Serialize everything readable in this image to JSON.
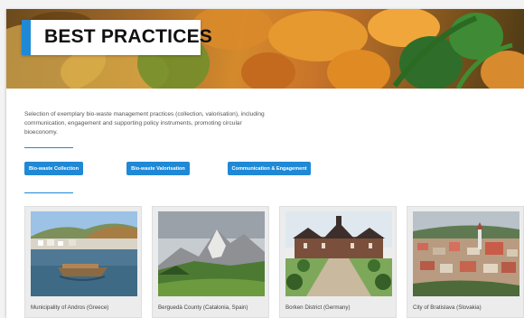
{
  "hero": {
    "title": "BEST PRACTICES",
    "accent_color": "#1f89d6"
  },
  "intro": {
    "text": "Selection of exemplary bio-waste management practices (collection, valorisation), including communication, engagement and supporting policy instruments, promoting circular bioeconomy."
  },
  "filters": {
    "collection": "Bio-waste Collection",
    "valorisation": "Bio-waste Valorisation",
    "communication": "Communication & Engagement"
  },
  "cards": [
    {
      "label": "Municipality of Andros (Greece)",
      "image": "andros-harbour-photo"
    },
    {
      "label": "Berguedà County (Catalonia, Spain)",
      "image": "mountain-landscape-photo"
    },
    {
      "label": "Borken District (Germany)",
      "image": "castle-garden-photo"
    },
    {
      "label": "City of Bratislava (Slovakia)",
      "image": "bratislava-city-photo"
    }
  ]
}
